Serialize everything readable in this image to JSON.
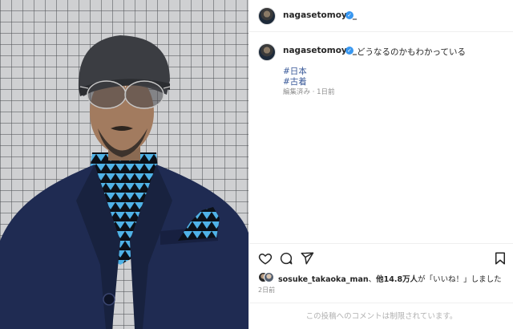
{
  "post": {
    "photo_alt": "",
    "author": {
      "username": "nagasetomoya_",
      "verified_mark": "✓"
    },
    "caption": {
      "username": "nagasetomoya_",
      "text": "どうなるのかもわかっている",
      "hashtags": [
        "#日本",
        "#古着"
      ],
      "meta": "編集済み · 1日前"
    },
    "actions": {
      "like": "heart-icon",
      "comment": "comment-icon",
      "share": "share-icon",
      "save": "bookmark-icon"
    },
    "likes": {
      "first_user": "sosuke_takaoka_man",
      "sep": "、",
      "others": "他14.8万人",
      "suffix": "が「いいね！」しました"
    },
    "posted_ago": "2日前",
    "comments_disabled": "この投稿へのコメントは制限されています。"
  },
  "colors": {
    "link": "#385898",
    "verified": "#3897f0",
    "muted": "#8e8e8e",
    "jacket": "#1f2b52",
    "shirt_pattern": "#4fb2e6"
  }
}
